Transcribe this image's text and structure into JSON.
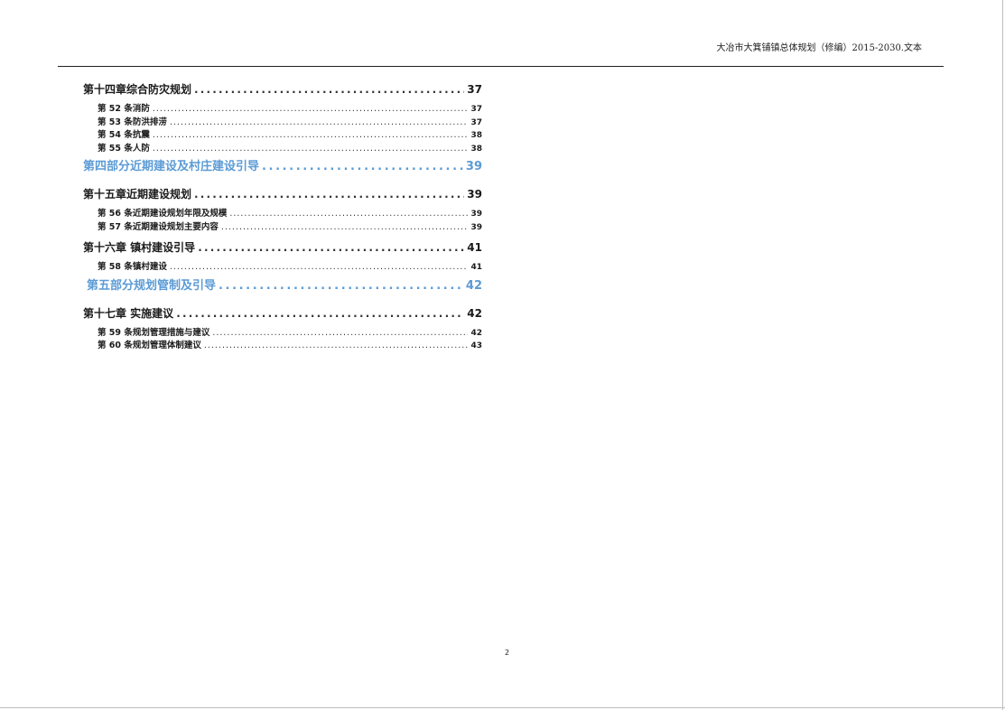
{
  "header": {
    "title": "大冶市大箕铺镇总体规划（修编）2015-2030.文本"
  },
  "toc": [
    {
      "type": "chapter",
      "label": "第十四章综合防灾规划",
      "page": "37"
    },
    {
      "type": "article",
      "label": "第 52 条消防",
      "page": "37"
    },
    {
      "type": "article",
      "label": "第 53 条防洪排涝",
      "page": "37"
    },
    {
      "type": "article",
      "label": "第 54 条抗震",
      "page": "38"
    },
    {
      "type": "article",
      "label": "第 55 条人防",
      "page": "38"
    },
    {
      "type": "part",
      "label": "第四部分近期建设及村庄建设引导",
      "page": "39"
    },
    {
      "type": "chapter",
      "label": "第十五章近期建设规划",
      "page": "39"
    },
    {
      "type": "article",
      "label": "第 56 条近期建设规划年限及规模",
      "page": "39"
    },
    {
      "type": "article",
      "label": "第 57 条近期建设规划主要内容",
      "page": "39"
    },
    {
      "type": "chapter",
      "label": "第十六章  镇村建设引导",
      "page": "41"
    },
    {
      "type": "article",
      "label": "第 58 条镇村建设",
      "page": "41"
    },
    {
      "type": "part",
      "label": "第五部分规划管制及引导",
      "page": "42"
    },
    {
      "type": "chapter",
      "label": "第十七章  实施建议",
      "page": "42"
    },
    {
      "type": "article",
      "label": "第 59 条规划管理措施与建议",
      "page": "42"
    },
    {
      "type": "article",
      "label": "第 60 条规划管理体制建议",
      "page": "43"
    }
  ],
  "footer": {
    "page_number": "2"
  }
}
